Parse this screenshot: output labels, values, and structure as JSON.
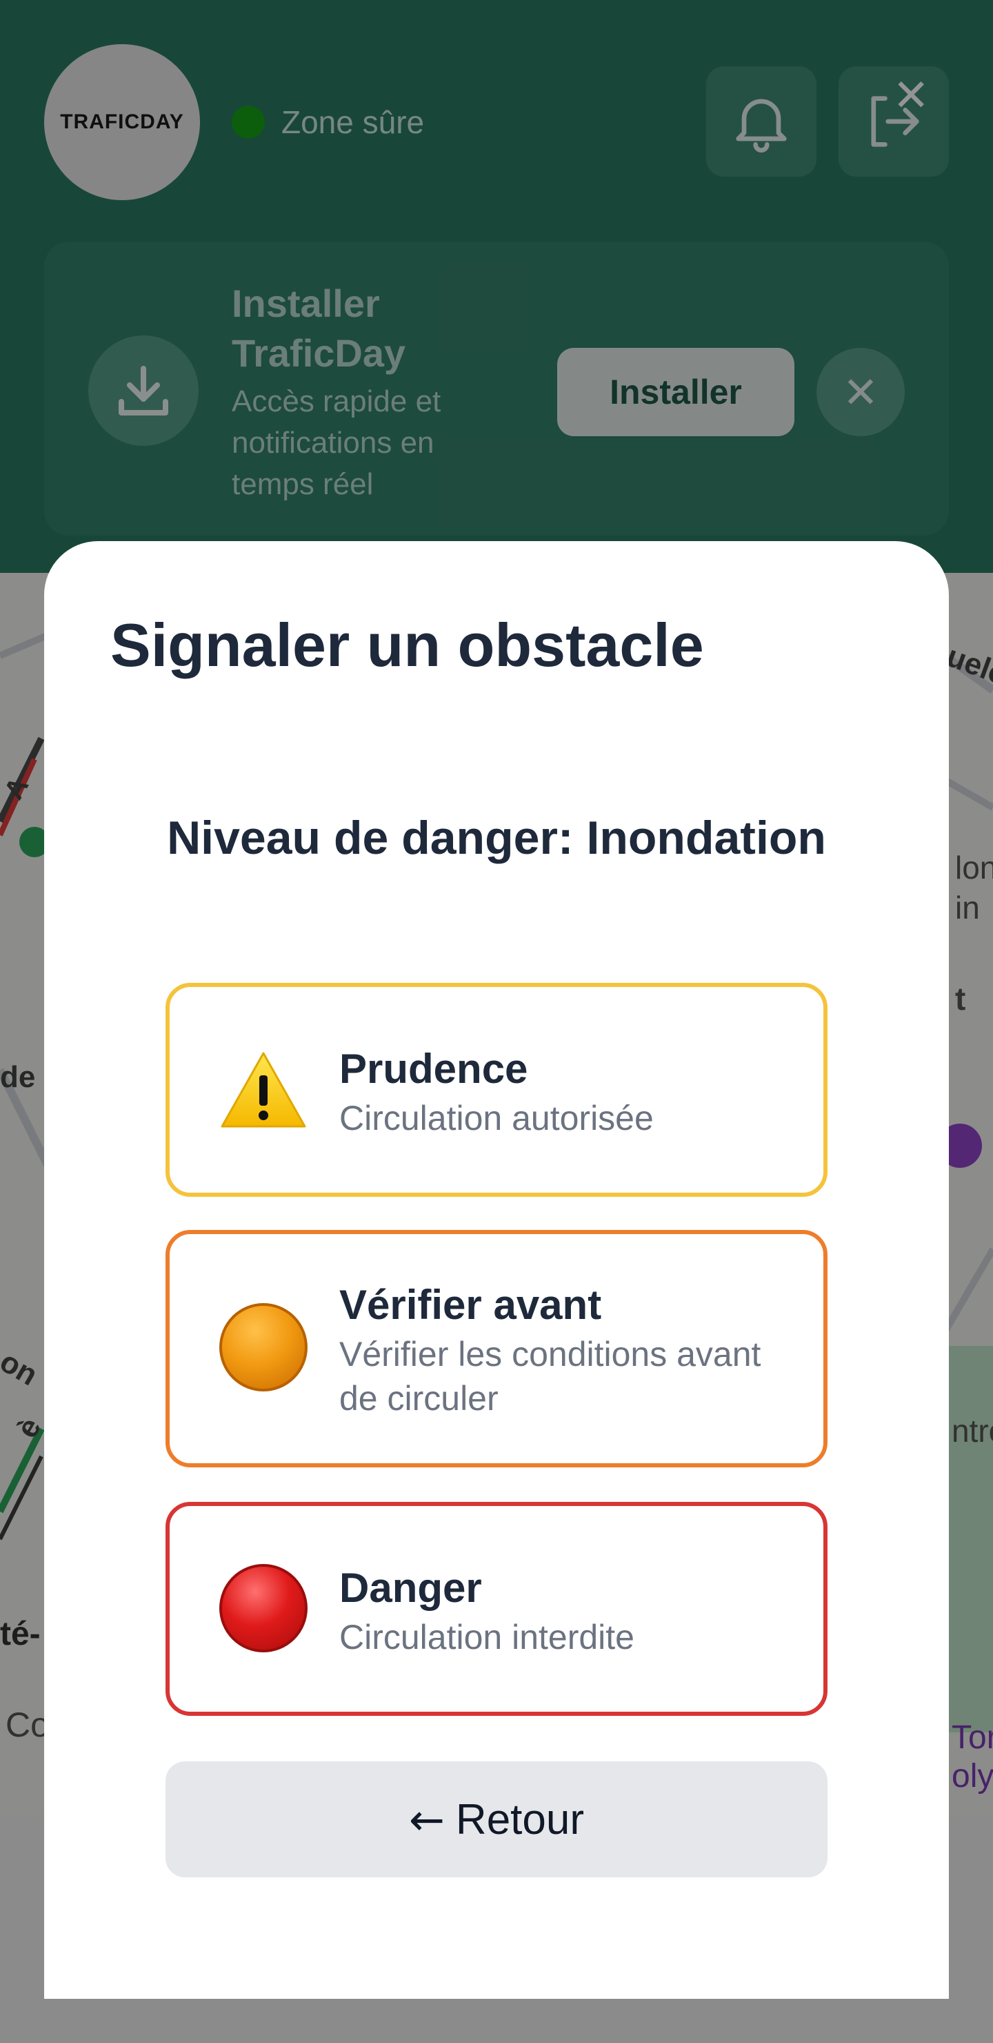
{
  "header": {
    "logo_text": "TRAFICDAY",
    "zone_label": "Zone sûre",
    "zone_color": "#16a016",
    "bell_icon": "bell-icon",
    "logout_icon": "logout-icon"
  },
  "install_banner": {
    "title": "Installer TraficDay",
    "subtitle": "Accès rapide et notifications en temps réel",
    "install_label": "Installer",
    "close_icon": "close-icon",
    "download_icon": "download-icon"
  },
  "modal": {
    "title": "Signaler un obstacle",
    "section_title": "Niveau de danger: Inondation",
    "options": [
      {
        "label": "Prudence",
        "description": "Circulation autorisée",
        "icon": "warning-icon",
        "border_color": "#f5c33b"
      },
      {
        "label": "Vérifier avant",
        "description": "Vérifier les conditions avant de circuler",
        "icon": "orange-circle-icon",
        "border_color": "#ee7d2b"
      },
      {
        "label": "Danger",
        "description": "Circulation interdite",
        "icon": "red-circle-icon",
        "border_color": "#d83535"
      }
    ],
    "back_arrow": "←",
    "back_label": "Retour"
  },
  "map_labels": {
    "right_1": "uelo",
    "right_2": "lon",
    "right_3": "in",
    "right_4": "t",
    "right_5": "ntre",
    "right_6": "Tor",
    "right_7": "oly",
    "left_1": "A",
    "left_2": "de",
    "left_3": "on",
    "left_4": "è",
    "left_5": "té-",
    "left_6": "Co"
  }
}
